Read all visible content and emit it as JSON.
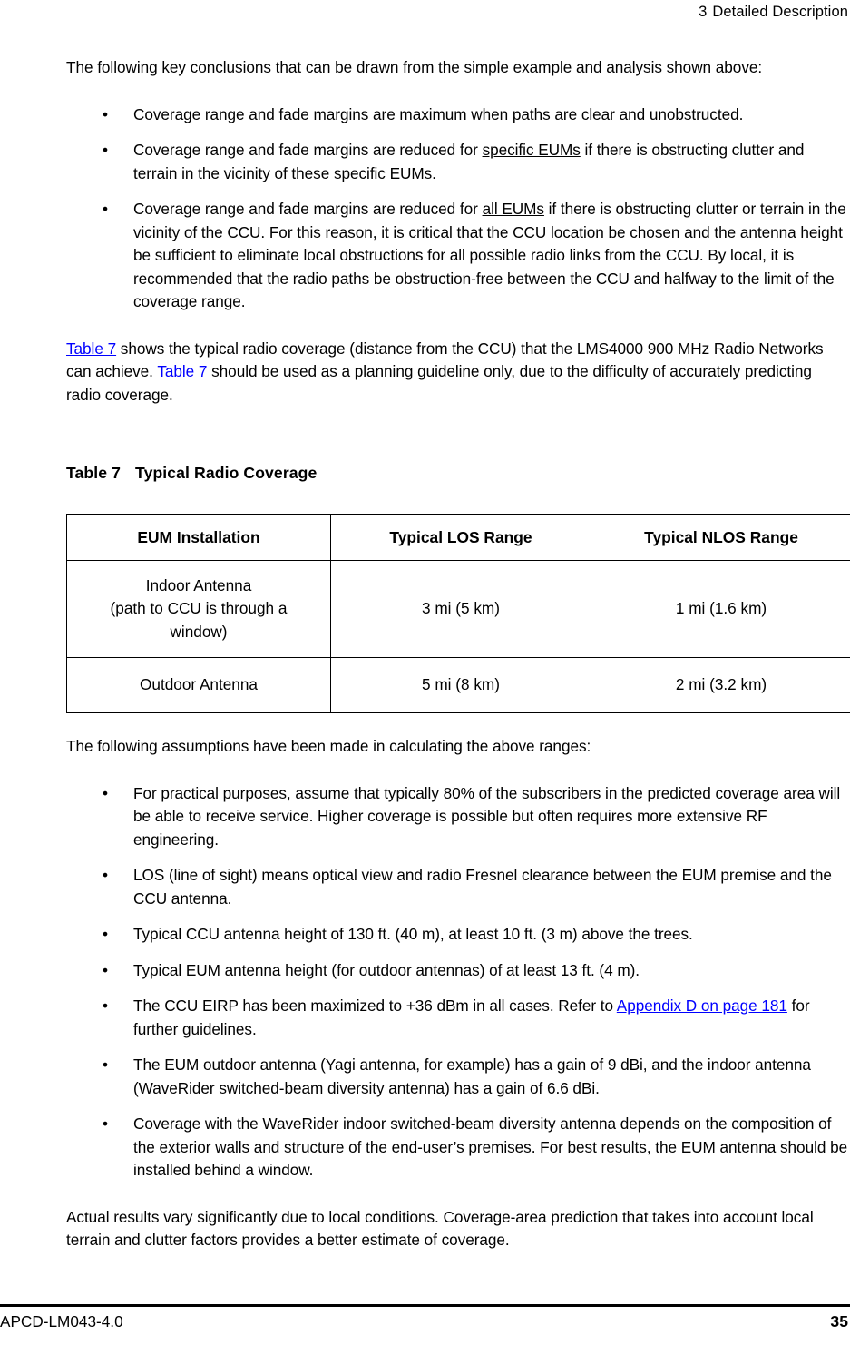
{
  "header": {
    "chapter_number": "3",
    "chapter_title": "Detailed Description"
  },
  "body": {
    "intro_paragraph": "The following key conclusions that can be drawn from the simple example and analysis shown above:",
    "conclusions_bullets": [
      {
        "marker": "•",
        "pre": "Coverage range and fade margins are maximum when paths are clear and unobstructed.",
        "underlined": "",
        "post": ""
      },
      {
        "marker": "•",
        "pre": "Coverage range and fade margins are reduced for ",
        "underlined": "specific EUMs",
        "post": " if there is obstructing clutter and terrain in the vicinity of these specific EUMs."
      },
      {
        "marker": "•",
        "pre": "Coverage range and fade margins are reduced for ",
        "underlined": "all EUMs",
        "post": " if there is obstructing clutter or terrain in the vicinity of the CCU. For this reason, it is critical that the CCU location be chosen and the antenna height be sufficient to eliminate local obstructions for all possible radio links from the CCU. By local, it is recommended that the radio paths be obstruction-free between the CCU and halfway to the limit of the coverage range."
      }
    ],
    "table_intro": {
      "link1": "Table 7",
      "text1": " shows the typical radio coverage (distance from the CCU) that the LMS4000 900 MHz Radio Networks can achieve. ",
      "link2": "Table 7",
      "text2": " should be used as a planning guideline only, due to the difficulty of accurately predicting radio coverage."
    },
    "assumptions_intro": "The following assumptions have been made in calculating the above ranges:",
    "assumption_bullets": [
      {
        "marker": "•",
        "pre": "For practical purposes, assume that typically 80% of the subscribers in the predicted coverage area will be able to receive service. Higher coverage is possible but often requires more extensive RF engineering.",
        "link": "",
        "post": ""
      },
      {
        "marker": "•",
        "pre": "LOS (line of sight) means optical view and radio Fresnel clearance between the EUM premise and the CCU antenna.",
        "link": "",
        "post": ""
      },
      {
        "marker": "•",
        "pre": "Typical CCU antenna height of 130 ft. (40 m), at least 10 ft. (3 m) above the trees.",
        "link": "",
        "post": ""
      },
      {
        "marker": "•",
        "pre": "Typical EUM antenna height (for outdoor antennas) of at least 13 ft. (4 m).",
        "link": "",
        "post": ""
      },
      {
        "marker": "•",
        "pre": "The CCU EIRP has been maximized to +36 dBm in all cases. Refer to ",
        "link": "Appendix D on page 181",
        "post": " for further guidelines."
      },
      {
        "marker": "•",
        "pre": "The EUM outdoor antenna (Yagi antenna, for example) has a gain of 9 dBi, and the indoor antenna (WaveRider switched-beam diversity antenna) has a gain of 6.6 dBi.",
        "link": "",
        "post": ""
      },
      {
        "marker": "•",
        "pre": "Coverage with the WaveRider indoor switched-beam diversity antenna depends on the composition of the exterior walls and structure of the end-user’s premises. For best results, the EUM antenna should be installed behind a window.",
        "link": "",
        "post": ""
      }
    ],
    "closing_paragraph": "Actual results vary significantly due to local conditions. Coverage-area prediction that takes into account local terrain and clutter factors provides a better estimate of coverage."
  },
  "table": {
    "caption_label": "Table 7",
    "caption_title": "Typical Radio Coverage",
    "columns": [
      "EUM Installation",
      "Typical LOS Range",
      "Typical NLOS Range"
    ],
    "rows": [
      {
        "installation_line1": "Indoor Antenna",
        "installation_line2": "(path to CCU is through a",
        "installation_line3": "window)",
        "los_range": "3 mi (5 km)",
        "nlos_range": "1 mi (1.6 km)"
      },
      {
        "installation_line1": "Outdoor Antenna",
        "installation_line2": "",
        "installation_line3": "",
        "los_range": "5 mi (8 km)",
        "nlos_range": "2 mi (3.2 km)"
      }
    ]
  },
  "footer": {
    "document_id": "APCD-LM043-4.0",
    "page_number": "35"
  },
  "colors": {
    "link": "#0000ff",
    "text": "#000000",
    "background": "#ffffff",
    "rule": "#000000"
  }
}
